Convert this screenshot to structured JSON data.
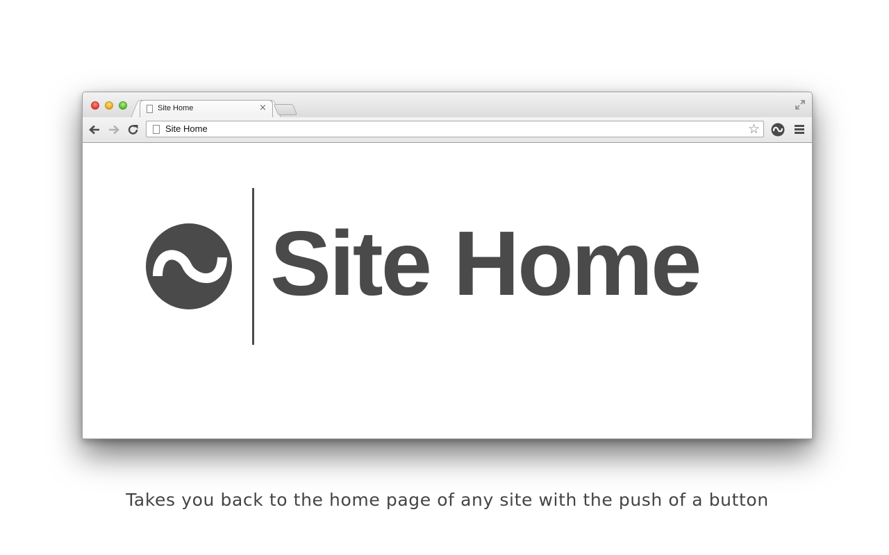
{
  "browser": {
    "tab": {
      "title": "Site Home",
      "close_glyph": "×"
    },
    "omnibox": {
      "text": "Site Home"
    },
    "icons": {
      "back": "arrow-left-icon",
      "forward": "arrow-right-icon",
      "reload": "reload-icon",
      "star": "star-icon",
      "extension": "site-home-extension-icon",
      "menu": "hamburger-menu-icon",
      "fullscreen": "fullscreen-icon"
    }
  },
  "page": {
    "hero_title": "Site Home",
    "logo": "tilde-circle-logo",
    "brand_color": "#4a4a4a"
  },
  "caption": "Takes you back to the home page of any site with the push of a button"
}
